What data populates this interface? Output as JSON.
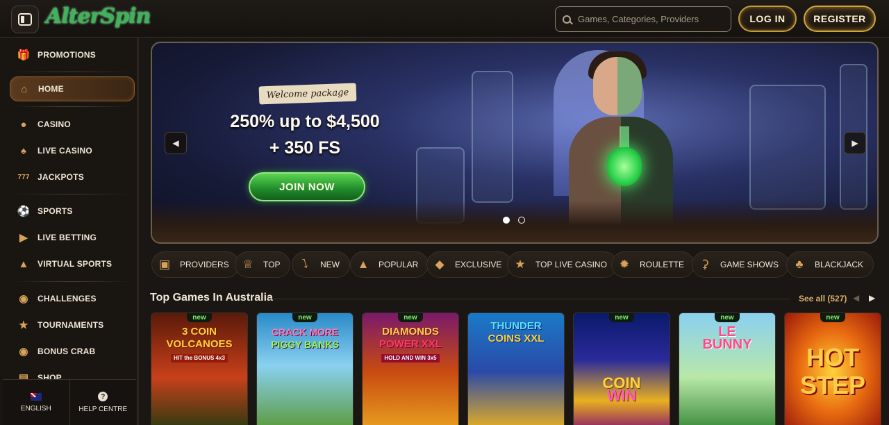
{
  "header": {
    "logo": "AlterSpin",
    "search_placeholder": "Games, Categories, Providers",
    "login": "LOG IN",
    "register": "REGISTER"
  },
  "sidebar": {
    "items": [
      {
        "label": "PROMOTIONS",
        "icon": "gift-icon"
      },
      {
        "label": "HOME",
        "icon": "home-icon"
      },
      {
        "label": "CASINO",
        "icon": "cherries-icon"
      },
      {
        "label": "LIVE CASINO",
        "icon": "card-icon"
      },
      {
        "label": "JACKPOTS",
        "icon": "777-icon"
      },
      {
        "label": "SPORTS",
        "icon": "ball-icon"
      },
      {
        "label": "LIVE BETTING",
        "icon": "play-icon"
      },
      {
        "label": "VIRTUAL SPORTS",
        "icon": "virtual-icon"
      },
      {
        "label": "CHALLENGES",
        "icon": "medal-icon"
      },
      {
        "label": "TOURNAMENTS",
        "icon": "trophy-icon"
      },
      {
        "label": "BONUS CRAB",
        "icon": "crab-icon"
      },
      {
        "label": "SHOP",
        "icon": "cart-icon"
      }
    ],
    "language": "ENGLISH",
    "help": "HELP CENTRE",
    "help_glyph": "?"
  },
  "banner": {
    "tag": "Welcome package",
    "offer_line1": "250% up to $4,500",
    "offer_line2": "+ 350 FS",
    "cta": "JOIN NOW",
    "active_slide": 1,
    "slides": 2
  },
  "categories": [
    {
      "label": "PROVIDERS",
      "icon": "book-icon"
    },
    {
      "label": "TOP",
      "icon": "crown-icon"
    },
    {
      "label": "NEW",
      "icon": "lightning-icon"
    },
    {
      "label": "POPULAR",
      "icon": "flame-icon"
    },
    {
      "label": "EXCLUSIVE",
      "icon": "diamond-icon"
    },
    {
      "label": "TOP LIVE CASINO",
      "icon": "star-icon"
    },
    {
      "label": "ROULETTE",
      "icon": "roulette-icon"
    },
    {
      "label": "GAME SHOWS",
      "icon": "microphone-icon"
    },
    {
      "label": "BLACKJACK",
      "icon": "cards-icon"
    }
  ],
  "top_games": {
    "title": "Top Games In Australia",
    "see_all": "See all (527)",
    "badge": "new",
    "games": [
      {
        "title_line1": "3 COIN",
        "title_line2": "VOLCANOES",
        "sub": "HIT the BONUS 4x3",
        "is_new": true
      },
      {
        "title_line1": "CRACK MORE",
        "title_line2": "PIGGY BANKS",
        "sub": "",
        "is_new": true
      },
      {
        "title_line1": "DIAMONDS",
        "title_line2": "POWER XXL",
        "sub": "HOLD AND WIN 3x5",
        "is_new": true
      },
      {
        "title_line1": "THUNDER",
        "title_line2": "COINS XXL",
        "sub": "",
        "is_new": false
      },
      {
        "title_line1": "COIN",
        "title_line2": "WIN",
        "sub": "",
        "is_new": true
      },
      {
        "title_line1": "LE",
        "title_line2": "BUNNY",
        "sub": "",
        "is_new": true
      },
      {
        "title_line1": "HOT",
        "title_line2": "STEP",
        "sub": "",
        "is_new": true
      }
    ]
  },
  "colors": {
    "accent_gold": "#d4a43c",
    "cta_green": "#1f8a2a",
    "badge_green": "#7ef06a"
  }
}
